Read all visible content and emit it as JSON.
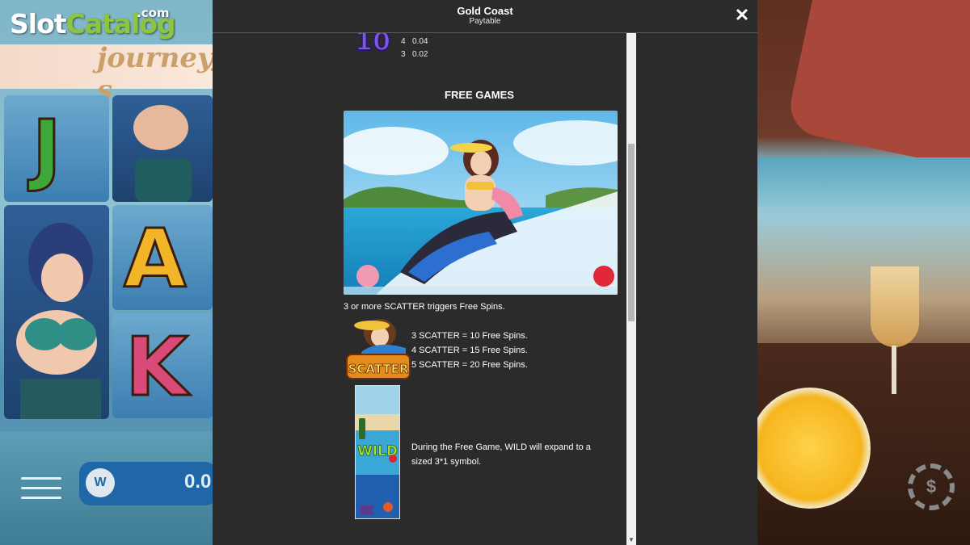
{
  "brand": {
    "logo_slot": "Slot",
    "logo_catalog": "Catalog",
    "logo_domain": ".com"
  },
  "background": {
    "journey_text": "journey, s",
    "reel_letters": [
      "J",
      "A",
      "K"
    ],
    "balance_value": "0.0",
    "coin_symbol": "W",
    "chip_symbol": "$"
  },
  "paytable": {
    "title": "Gold Coast",
    "subtitle": "Paytable",
    "close_icon": "✕",
    "symbol_10": {
      "label": "10",
      "payouts": [
        {
          "count": "4",
          "value": "0.04"
        },
        {
          "count": "3",
          "value": "0.02"
        }
      ]
    },
    "free_games": {
      "heading": "FREE GAMES",
      "trigger_text": "3 or more SCATTER triggers Free Spins.",
      "scatter_label": "SCATTER",
      "scatter_rules": [
        "3 SCATTER = 10 Free Spins.",
        "4 SCATTER = 15 Free Spins.",
        "5 SCATTER = 20 Free Spins."
      ],
      "wild_label": "WILD",
      "wild_text_line1": "During the Free Game, WILD will expand to a",
      "wild_text_line2": "sized 3*1 symbol."
    }
  },
  "colors": {
    "panel_bg": "#2b2b2b",
    "brand_green": "#8cc63f",
    "ten_purple": "#6a3fd4",
    "scatter_orange": "#e58a1c",
    "wild_green": "#9bd13a"
  }
}
